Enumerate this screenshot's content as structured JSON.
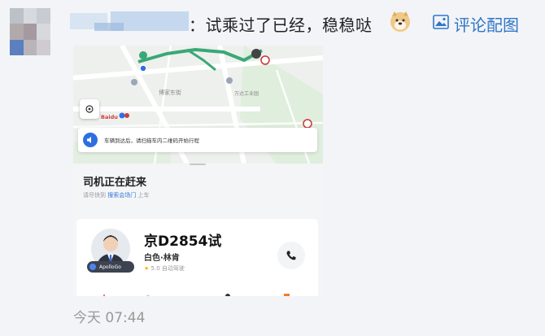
{
  "post": {
    "text": "：试乘过了已经，稳稳哒",
    "emoji": "doge-emoji",
    "photo_comment_label": "评论配图",
    "time": "今天 07:44"
  },
  "app_screenshot": {
    "notice": "车辆到达后，请扫描车内二维码开始行程",
    "status_title": "司机正在赶来",
    "status_sub_prefix": "请尽快到",
    "status_sub_place": "搜索会场门",
    "status_sub_suffix": "上车",
    "map_street": "博家东街",
    "map_place": "万达工业园",
    "brand": "Baidu",
    "driver": {
      "plate": "京D2854试",
      "car": "白色·林肯",
      "rating": "5.0",
      "rating_label": "自动驾驶",
      "badge": "ApolloGo"
    }
  },
  "colors": {
    "link": "#2f76c8",
    "accent": "#2e6fe0",
    "route": "#3aa876"
  }
}
